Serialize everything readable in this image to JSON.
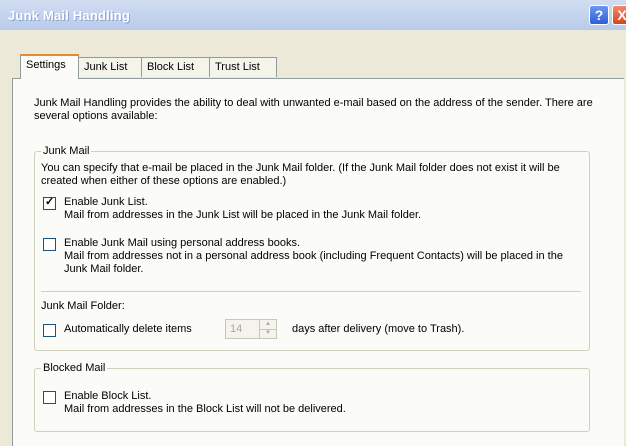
{
  "window": {
    "title": "Junk Mail Handling",
    "help_glyph": "?",
    "close_glyph": "X"
  },
  "tabs": [
    {
      "label": "Settings",
      "active": true
    },
    {
      "label": "Junk List",
      "active": false
    },
    {
      "label": "Block List",
      "active": false
    },
    {
      "label": "Trust List",
      "active": false
    }
  ],
  "settings": {
    "intro": "Junk Mail Handling provides the ability to deal with unwanted e-mail based on the address of the sender.  There are several options available:",
    "junk_group": {
      "legend": "Junk Mail",
      "description": "You can specify that e-mail be placed in the Junk Mail folder.  (If the Junk Mail folder does not exist it will be created when either of these options are enabled.)",
      "enable_junk_list": {
        "checked": true,
        "label": "Enable Junk List.",
        "detail": "Mail from addresses in the Junk List will be placed in the Junk Mail folder."
      },
      "enable_personal_books": {
        "checked": false,
        "label": "Enable Junk Mail using personal address books.",
        "detail": "Mail from addresses not in a personal address book (including Frequent Contacts) will be placed in the Junk Mail folder."
      },
      "folder_label": "Junk Mail Folder:",
      "auto_delete": {
        "checked": false,
        "label": "Automatically delete items",
        "days_value": "14",
        "suffix": "days after delivery (move to Trash)."
      }
    },
    "blocked_group": {
      "legend": "Blocked Mail",
      "enable_block_list": {
        "checked": false,
        "label": "Enable Block List.",
        "detail": "Mail from addresses in the Block List will not be delivered."
      }
    }
  },
  "colors": {
    "title_bar": "#c7d6ef",
    "dialog_bg": "#ece9d8",
    "tab_highlight": "#e68b2c",
    "help_button": "#2d5ed8",
    "close_button": "#d8431f"
  }
}
